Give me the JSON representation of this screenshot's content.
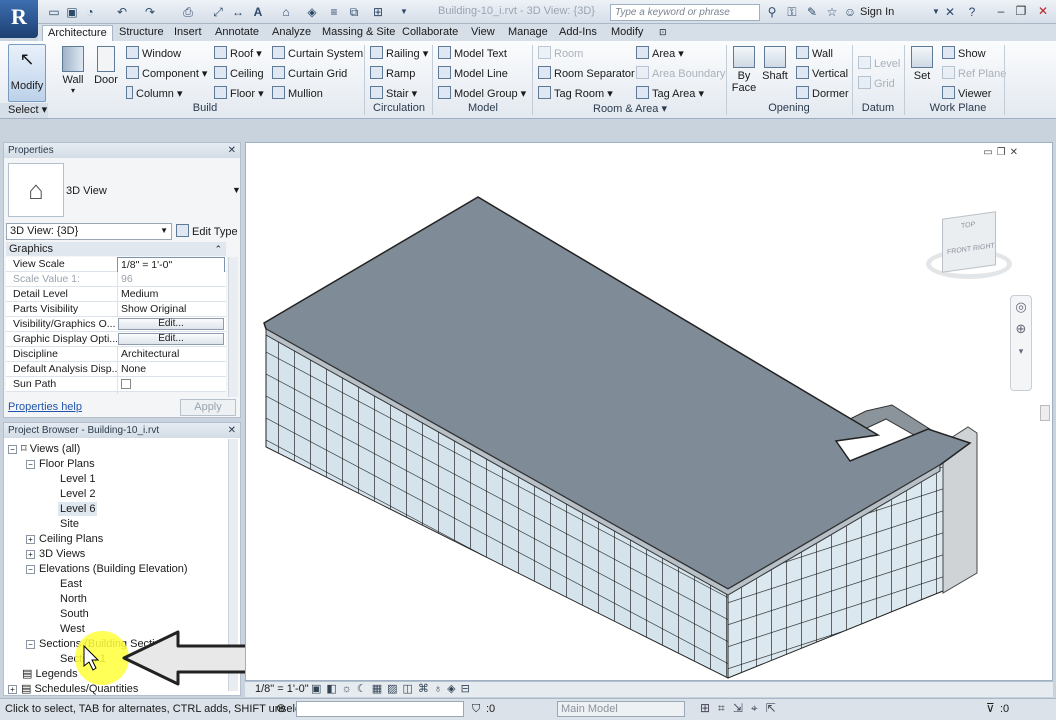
{
  "app": {
    "logo_letter": "R",
    "document_title": "Building-10_i.rvt - 3D View: {3D}"
  },
  "titlebar": {
    "search_placeholder": "Type a keyword or phrase",
    "sign_in": "Sign In"
  },
  "ribbon_tabs": [
    "Architecture",
    "Structure",
    "Insert",
    "Annotate",
    "Analyze",
    "Massing & Site",
    "Collaborate",
    "View",
    "Manage",
    "Add-Ins",
    "Modify"
  ],
  "ribbon": {
    "modify": "Modify",
    "select": "Select",
    "wall": "Wall",
    "door": "Door",
    "build": {
      "window": "Window",
      "component": "Component",
      "column": "Column",
      "roof": "Roof",
      "ceiling": "Ceiling",
      "floor": "Floor",
      "curtain_system": "Curtain System",
      "curtain_grid": "Curtain Grid",
      "mullion": "Mullion"
    },
    "circulation": {
      "railing": "Railing",
      "ramp": "Ramp",
      "stair": "Stair"
    },
    "model": {
      "model_text": "Model  Text",
      "model_line": "Model  Line",
      "model_group": "Model  Group"
    },
    "room_area": {
      "room": "Room",
      "room_separator": "Room  Separator",
      "tag_room": "Tag  Room",
      "area": "Area",
      "area_boundary": "Area  Boundary",
      "tag_area": "Tag  Area"
    },
    "opening": {
      "by_face": "By Face",
      "shaft": "Shaft",
      "wall": "Wall",
      "vertical": "Vertical",
      "dormer": "Dormer"
    },
    "datum": {
      "level": "Level",
      "grid": "Grid"
    },
    "work_plane": {
      "set": "Set",
      "show": "Show",
      "ref_plane": "Ref  Plane",
      "viewer": "Viewer"
    },
    "panels": [
      "Build",
      "Circulation",
      "Model",
      "Room & Area",
      "Opening",
      "Datum",
      "Work Plane"
    ]
  },
  "properties": {
    "title": "Properties",
    "type_name": "3D View",
    "view_selector": "3D View: {3D}",
    "edit_type": "Edit Type",
    "group": "Graphics",
    "rows": [
      {
        "k": "View Scale",
        "v": "1/8\" = 1'-0\""
      },
      {
        "k": "Scale Value    1:",
        "v": "96"
      },
      {
        "k": "Detail Level",
        "v": "Medium"
      },
      {
        "k": "Parts Visibility",
        "v": "Show Original"
      },
      {
        "k": "Visibility/Graphics O...",
        "v": "Edit..."
      },
      {
        "k": "Graphic Display Opti...",
        "v": "Edit..."
      },
      {
        "k": "Discipline",
        "v": "Architectural"
      },
      {
        "k": "Default Analysis Disp...",
        "v": "None"
      },
      {
        "k": "Sun Path",
        "v": ""
      }
    ],
    "help": "Properties help",
    "apply": "Apply"
  },
  "browser": {
    "title": "Project Browser - Building-10_i.rvt",
    "views_all": "Views (all)",
    "floor_plans": "Floor Plans",
    "levels": [
      "Level 1",
      "Level 2",
      "Level 6",
      "Site"
    ],
    "ceiling_plans": "Ceiling Plans",
    "views_3d": "3D Views",
    "elevations": "Elevations (Building Elevation)",
    "elevs": [
      "East",
      "North",
      "South",
      "West"
    ],
    "sections": "Sections (Building Section)",
    "section_1": "Section 1",
    "legends": "Legends",
    "schedules": "Schedules/Quantities"
  },
  "viewport": {
    "scale": "1/8\" = 1'-0\"",
    "viewcube": {
      "top": "TOP",
      "front": "FRONT",
      "right": "RIGHT"
    }
  },
  "status": {
    "text": "Click to select, TAB for alternates, CTRL adds, SHIFT unselects",
    "count": ":0",
    "model": "Main Model",
    "filter": ":0"
  },
  "colors": {
    "roof": "#7f8b96",
    "glass": "#cfe0ea",
    "highlight": "#ffff3a"
  }
}
